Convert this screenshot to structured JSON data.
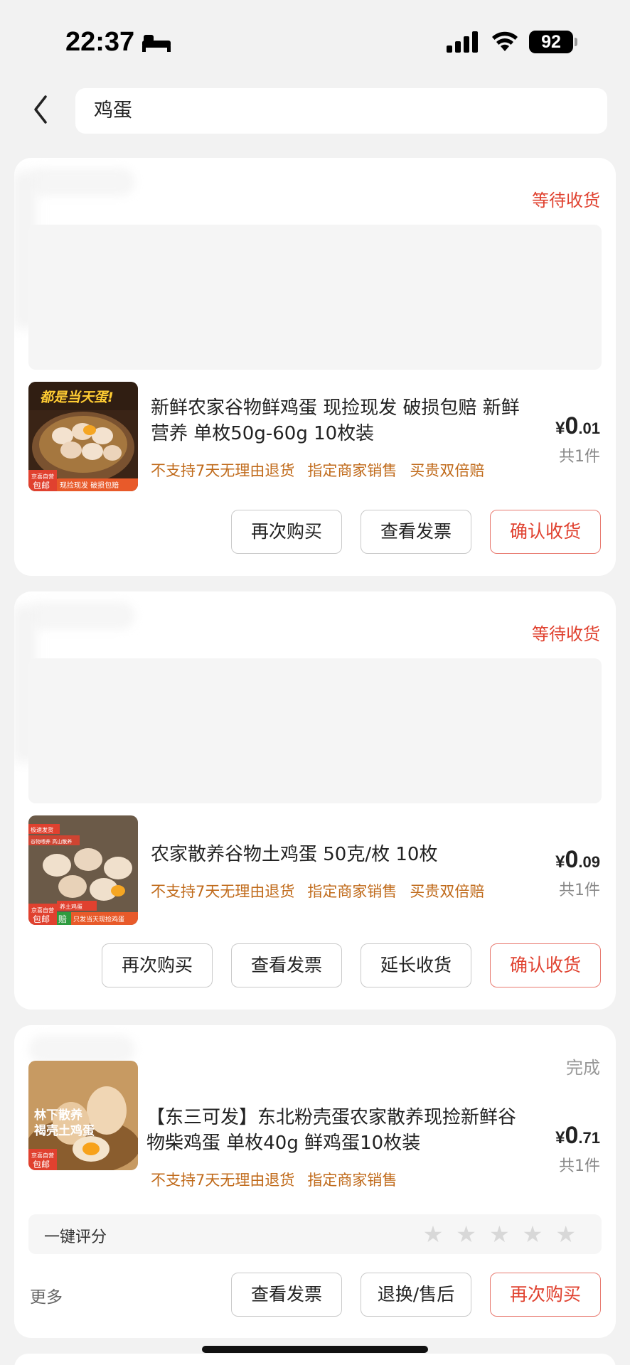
{
  "status_bar": {
    "time": "22:37",
    "battery": "92"
  },
  "search": {
    "query": "鸡蛋"
  },
  "orders": [
    {
      "status": "等待收货",
      "title": "新鲜农家谷物鲜鸡蛋  现捡现发 破损包赔 新鲜营养 单枚50g-60g 10枚装",
      "tags": [
        "不支持7天无理由退货",
        "指定商家销售",
        "买贵双倍赔"
      ],
      "price_symbol": "¥",
      "price_int": "0",
      "price_dec": ".01",
      "count": "共1件",
      "thumb_text": [
        "都是当天蛋!",
        "京喜自营",
        "包邮",
        "现捡现发 破损包赔"
      ],
      "buttons": [
        "再次购买",
        "查看发票",
        "确认收货"
      ]
    },
    {
      "status": "等待收货",
      "title": "农家散养谷物土鸡蛋 50克/枚 10枚",
      "tags": [
        "不支持7天无理由退货",
        "指定商家销售",
        "买贵双倍赔"
      ],
      "price_symbol": "¥",
      "price_int": "0",
      "price_dec": ".09",
      "count": "共1件",
      "thumb_text": [
        "极速发货",
        "谷物喂养 高山散养",
        "养土鸡蛋",
        "京喜自营",
        "包邮",
        "赔",
        "只发当天现捡鸡蛋"
      ],
      "buttons": [
        "再次购买",
        "查看发票",
        "延长收货",
        "确认收货"
      ]
    },
    {
      "status": "完成",
      "title": "【东三可发】东北粉壳蛋农家散养现捡新鲜谷物柴鸡蛋 单枚40g 鲜鸡蛋10枚装",
      "tags": [
        "不支持7天无理由退货",
        "指定商家销售"
      ],
      "price_symbol": "¥",
      "price_int": "0",
      "price_dec": ".71",
      "count": "共1件",
      "thumb_text": [
        "林下散养",
        "褐壳土鸡蛋",
        "京喜自营",
        "包邮"
      ],
      "rating_label": "一键评分",
      "more_label": "更多",
      "buttons": [
        "查看发票",
        "退换/售后",
        "再次购买"
      ]
    }
  ],
  "colors": {
    "accent": "#e0412f",
    "tag": "#c06a1a",
    "background": "#f2f2f2"
  }
}
